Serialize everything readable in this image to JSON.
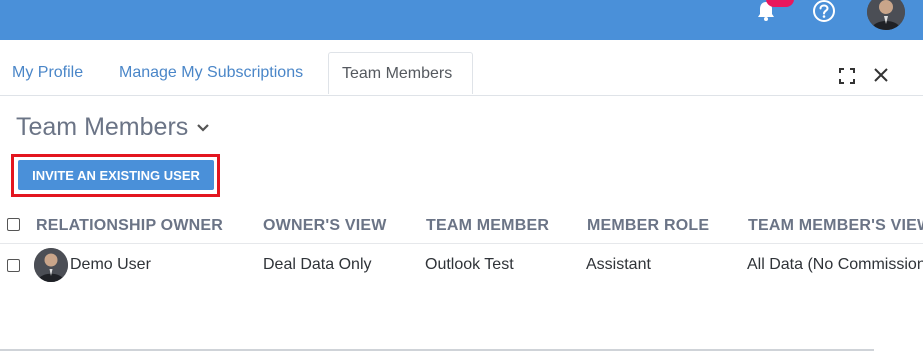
{
  "header": {
    "bell_icon": "bell-icon",
    "help_icon": "question-circle-icon",
    "avatar": "user-avatar",
    "badge_color": "#e8175d",
    "bar_color": "#4a90d9"
  },
  "tabs": [
    {
      "label": "My Profile"
    },
    {
      "label": "Manage My Subscriptions"
    },
    {
      "label": "Team Members"
    }
  ],
  "active_tab": "Team Members",
  "window_controls": {
    "expand_icon": "fullscreen-icon",
    "close_icon": "close-icon"
  },
  "page": {
    "title": "Team Members"
  },
  "invite_button": {
    "label": "INVITE AN EXISTING USER",
    "highlight_color": "#e3151f"
  },
  "table": {
    "columns": [
      "RELATIONSHIP OWNER",
      "OWNER'S VIEW",
      "TEAM MEMBER",
      "MEMBER ROLE",
      "TEAM MEMBER'S VIEW"
    ],
    "rows": [
      {
        "owner": "Demo User",
        "owners_view": "Deal Data Only",
        "team_member": "Outlook Test",
        "member_role": "Assistant",
        "team_members_view": "All Data (No Commission)"
      }
    ]
  }
}
